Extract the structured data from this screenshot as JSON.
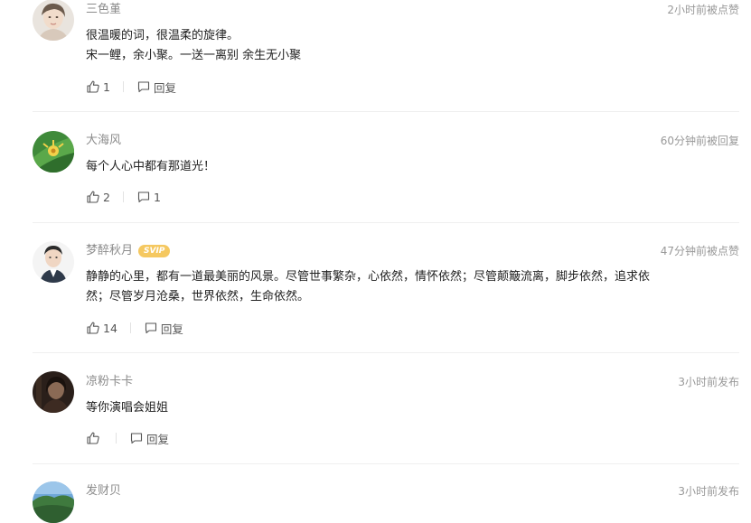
{
  "comments": [
    {
      "username": "三色堇",
      "timestamp": "2小时前被点赞",
      "lines": [
        "很温暖的词，很温柔的旋律。",
        "宋一鲤，余小聚。一送一离别 余生无小聚"
      ],
      "likes": "1",
      "reply_label": "回复",
      "avatar_icon": "woman-portrait-avatar"
    },
    {
      "username": "大海风",
      "timestamp": "60分钟前被回复",
      "lines": [
        "每个人心中都有那道光！"
      ],
      "likes": "2",
      "replies": "1",
      "avatar_icon": "green-leaf-flower-avatar"
    },
    {
      "username": "梦醉秋月",
      "badge": "SVIP",
      "timestamp": "47分钟前被点赞",
      "lines": [
        "静静的心里，都有一道最美丽的风景。尽管世事繁杂，心依然，情怀依然；尽管颠簸流离，脚步依然，追求依",
        "然；尽管岁月沧桑，世界依然，生命依然。"
      ],
      "likes": "14",
      "reply_label": "回复",
      "avatar_icon": "man-portrait-avatar"
    },
    {
      "username": "凉粉卡卡",
      "timestamp": "3小时前发布",
      "lines": [
        "等你演唱会姐姐"
      ],
      "reply_label": "回复",
      "avatar_icon": "dark-portrait-avatar"
    },
    {
      "username": "发财贝",
      "timestamp": "3小时前发布",
      "avatar_icon": "landscape-avatar"
    }
  ],
  "colors": {
    "username": "#8c8c8c",
    "text": "#222222",
    "timestamp": "#999999",
    "svip_badge": "#f5c860",
    "divider": "#efefef"
  }
}
